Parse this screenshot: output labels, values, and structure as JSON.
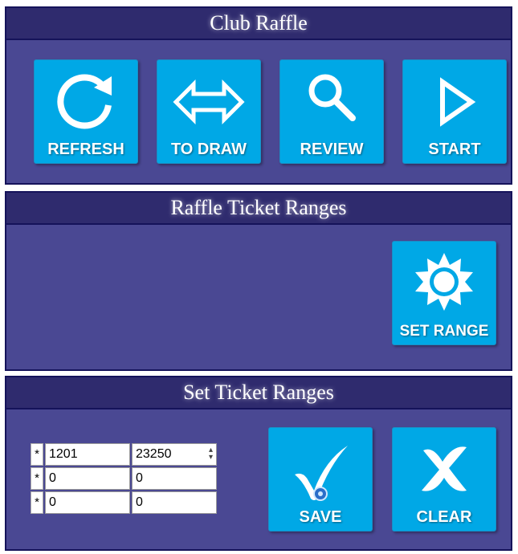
{
  "panels": {
    "club_raffle": {
      "title": "Club Raffle",
      "buttons": [
        {
          "label": "REFRESH",
          "icon": "refresh-icon"
        },
        {
          "label": "TO DRAW",
          "icon": "double-arrow-icon"
        },
        {
          "label": "REVIEW",
          "icon": "search-icon"
        },
        {
          "label": "START",
          "icon": "play-icon"
        }
      ]
    },
    "ticket_ranges": {
      "title": "Raffle Ticket Ranges",
      "set_range_label": "SET RANGE",
      "set_range_icon": "sun-icon"
    },
    "set_ticket_ranges": {
      "title": "Set Ticket Ranges",
      "rows": [
        {
          "marker": "*",
          "from": "1201",
          "to": "23250"
        },
        {
          "marker": "*",
          "from": "0",
          "to": "0"
        },
        {
          "marker": "*",
          "from": "0",
          "to": "0"
        }
      ],
      "save_label": "SAVE",
      "save_icon": "checkmark-icon",
      "clear_label": "CLEAR",
      "clear_icon": "clear-x-icon"
    }
  },
  "colors": {
    "panel_bg": "#4a4893",
    "header_bg": "#2f2b6e",
    "tile_bg": "#00a8e6",
    "border": "#15135a"
  }
}
